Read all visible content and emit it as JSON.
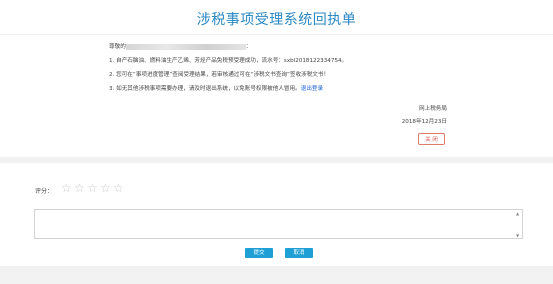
{
  "page": {
    "title": "涉税事项受理系统回执单"
  },
  "receipt": {
    "greeting_prefix": "尊敬的",
    "greeting_suffix": "：",
    "line1": "1. 自产石脑油、燃料油生产乙烯、芳烃产品免税预受理成功，流水号：sxbl2018122334754。",
    "line2": "2. 您可在“事项进度管理”查阅受理结果，若审核通过可在“涉税文书查询”签收涉税文书！",
    "line3_prefix": "3. 如无其他涉税事项需要办理，请及时退出系统，以免账号权限被他人冒用。",
    "logout_link": "退出登录",
    "issuer": "网上税务局",
    "date": "2018年12月23日",
    "close_label": "关 闭"
  },
  "rating": {
    "label": "评分：",
    "stars_total": 5,
    "stars_selected": 0
  },
  "comment": {
    "value": "",
    "placeholder": ""
  },
  "actions": {
    "submit_label": "提交",
    "cancel_label": "取消"
  },
  "colors": {
    "title": "#2a88c6",
    "button": "#1ea0d6",
    "close_border": "#e07a6a",
    "star_empty": "#c9c9c9"
  }
}
